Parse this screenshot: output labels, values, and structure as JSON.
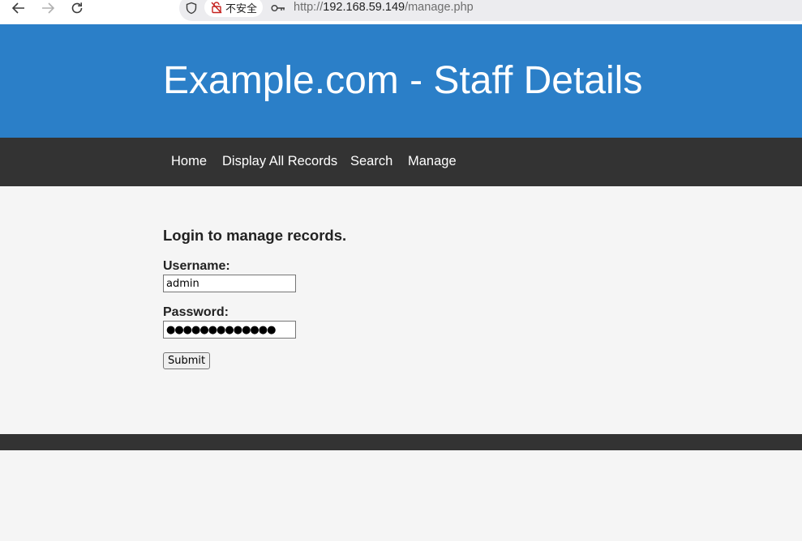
{
  "browser": {
    "back_icon": "arrow-left-icon",
    "forward_icon": "arrow-right-icon",
    "reload_icon": "reload-icon",
    "security_label": "不安全",
    "url_scheme": "http://",
    "url_host": "192.168.59.149",
    "url_path": "/manage.php"
  },
  "header": {
    "title": "Example.com - Staff Details",
    "background": "#2b7fc8"
  },
  "nav": {
    "background": "#333333",
    "items": [
      {
        "label": "Home"
      },
      {
        "label": "Display All Records"
      },
      {
        "label": "Search"
      },
      {
        "label": "Manage"
      }
    ]
  },
  "login": {
    "heading": "Login to manage records.",
    "username_label": "Username:",
    "username_value": "admin",
    "password_label": "Password:",
    "password_value": "●●●●●●●●●●●●●",
    "submit_label": "Submit"
  }
}
